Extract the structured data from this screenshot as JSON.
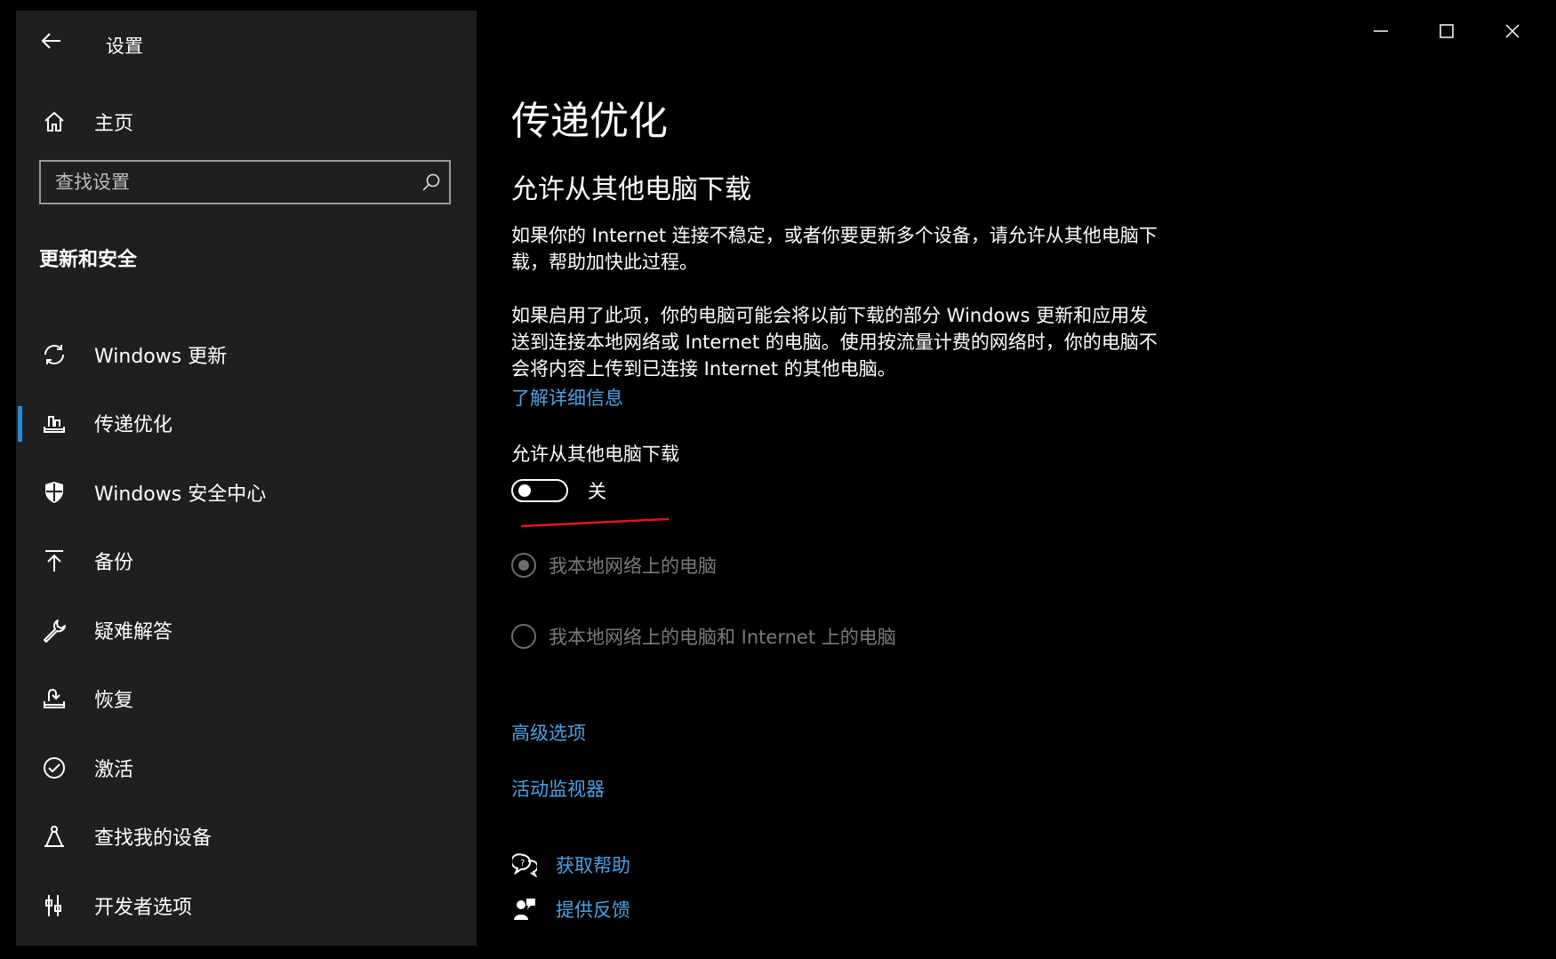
{
  "window": {
    "app_title": "设置",
    "controls": [
      "minimize",
      "maximize",
      "close"
    ]
  },
  "sidebar": {
    "home_label": "主页",
    "search": {
      "placeholder": "查找设置",
      "value": ""
    },
    "section_heading": "更新和安全",
    "items": [
      {
        "label": "Windows 更新",
        "icon": "sync-icon",
        "active": false
      },
      {
        "label": "传递优化",
        "icon": "delivery-optimization-icon",
        "active": true
      },
      {
        "label": "Windows 安全中心",
        "icon": "shield-icon",
        "active": false
      },
      {
        "label": "备份",
        "icon": "backup-arrow-icon",
        "active": false
      },
      {
        "label": "疑难解答",
        "icon": "wrench-icon",
        "active": false
      },
      {
        "label": "恢复",
        "icon": "recovery-icon",
        "active": false
      },
      {
        "label": "激活",
        "icon": "check-circle-icon",
        "active": false
      },
      {
        "label": "查找我的设备",
        "icon": "find-device-icon",
        "active": false
      },
      {
        "label": "开发者选项",
        "icon": "developer-tools-icon",
        "active": false
      }
    ]
  },
  "main": {
    "title": "传递优化",
    "subheading": "允许从其他电脑下载",
    "paragraph1": "如果你的 Internet 连接不稳定，或者你要更新多个设备，请允许从其他电脑下载，帮助加快此过程。",
    "paragraph2": "如果启用了此项，你的电脑可能会将以前下载的部分 Windows 更新和应用发送到连接本地网络或 Internet 的电脑。使用按流量计费的网络时，你的电脑不会将内容上传到已连接 Internet 的其他电脑。",
    "learn_more": "了解详细信息",
    "setting_label": "允许从其他电脑下载",
    "toggle": {
      "state_text": "关",
      "on": false
    },
    "radio_options": [
      {
        "label": "我本地网络上的电脑",
        "selected": true,
        "disabled": true
      },
      {
        "label": "我本地网络上的电脑和 Internet 上的电脑",
        "selected": false,
        "disabled": true
      }
    ],
    "advanced_options": "高级选项",
    "activity_monitor": "活动监视器",
    "get_help": "获取帮助",
    "give_feedback": "提供反馈"
  },
  "colors": {
    "sidebar_bg": "#1f1f1f",
    "content_bg": "#000000",
    "link": "#4aa3e6",
    "accent": "#2b88d8",
    "annotation": "#e81123"
  }
}
